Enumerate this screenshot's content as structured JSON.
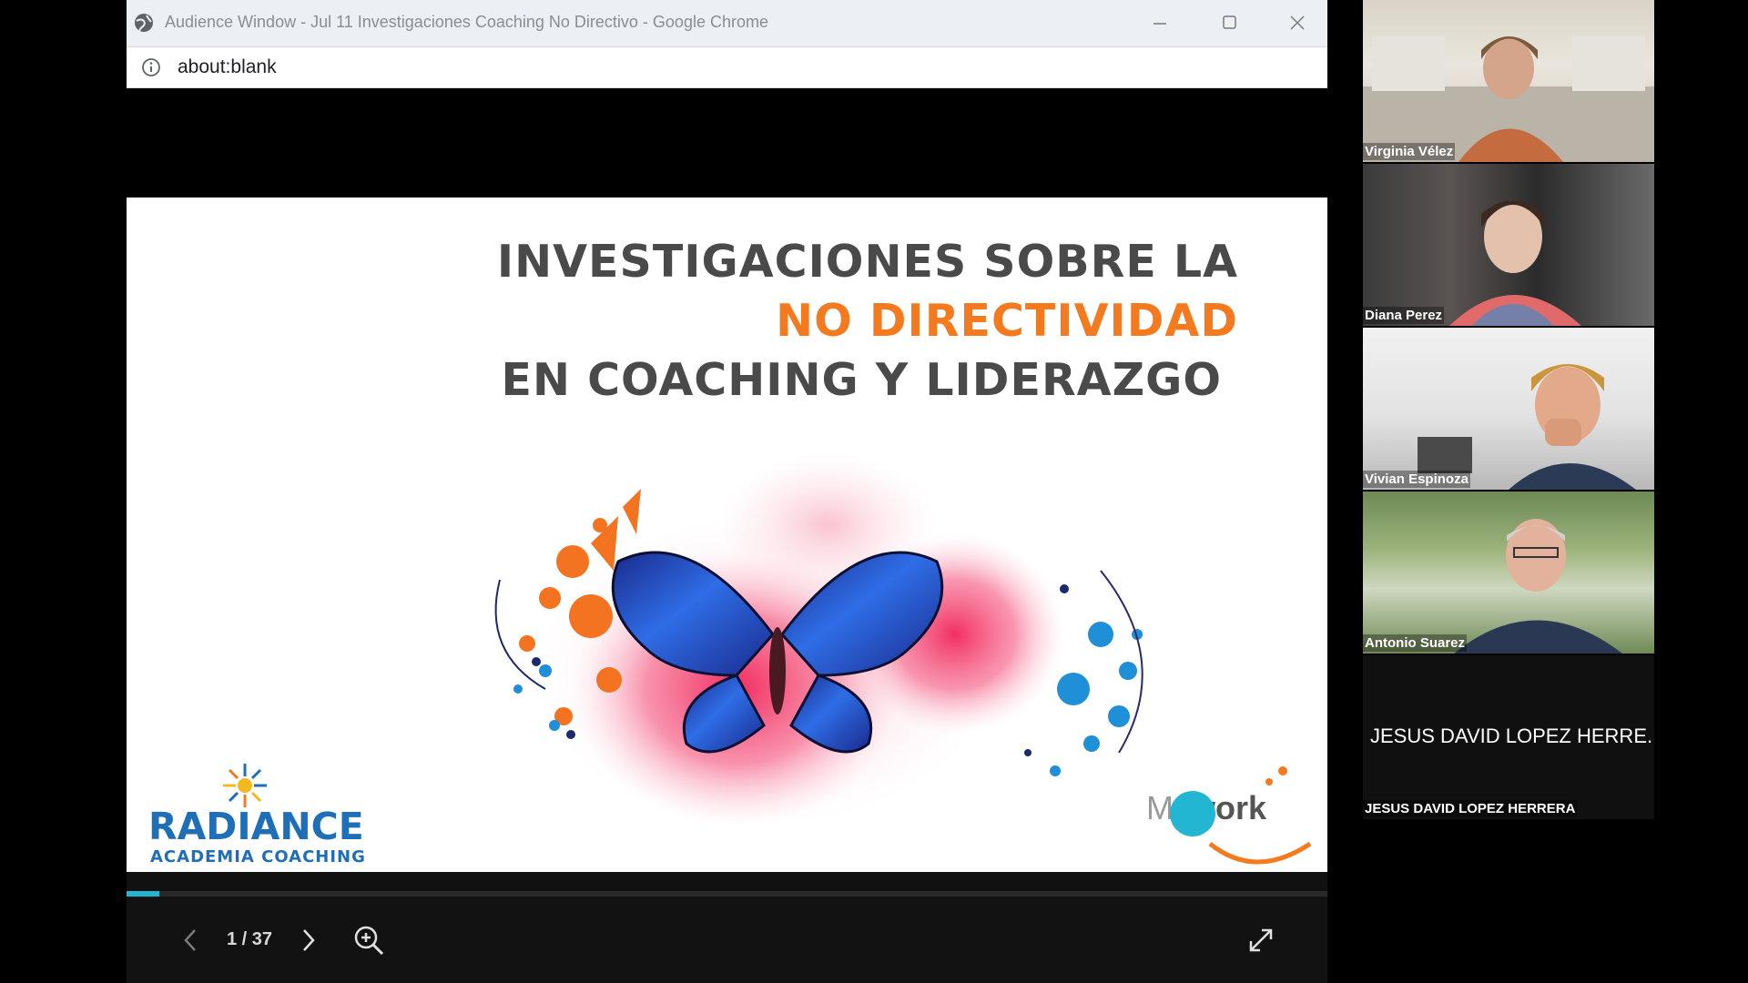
{
  "window": {
    "title": "Audience Window - Jul 11 Investigaciones Coaching No Directivo - Google Chrome",
    "url": "about:blank"
  },
  "slide": {
    "title_line1": "INVESTIGACIONES SOBRE LA",
    "title_line2": "NO DIRECTIVIDAD",
    "title_line3": "EN COACHING Y LIDERAZGO",
    "accent_color": "#f47a20",
    "logo_left_name": "RADIANCE",
    "logo_left_sub": "ACADEMIA COACHING",
    "logo_right_brand_light": "My",
    "logo_right_brand_bold": "work"
  },
  "viewer": {
    "page_indicator": "1 / 37",
    "current_page": 1,
    "total_pages": 37,
    "progress_fraction": 0.027
  },
  "participants": [
    {
      "name": "Virginia Vélez"
    },
    {
      "name": "Diana Perez"
    },
    {
      "name": "Vivian Espinoza"
    },
    {
      "name": "Antonio Suarez"
    },
    {
      "name": "JESUS DAVID LOPEZ HERRERA",
      "display_name": "JESUS DAVID LOPEZ HERRE..."
    }
  ]
}
